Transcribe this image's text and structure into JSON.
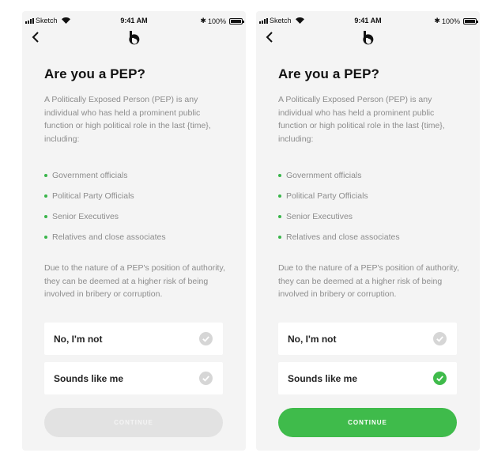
{
  "status_bar": {
    "carrier": "Sketch",
    "time": "9:41 AM",
    "battery": "100%"
  },
  "title": "Are you a PEP?",
  "intro": "A Politically Exposed Person (PEP) is any individual who has held a prominent public function or high political role in the last {time}, including:",
  "bullets": [
    "Government officials",
    "Political Party Officials",
    "Senior Executives",
    "Relatives and close associates"
  ],
  "explanation": "Due to the nature of a PEP's position of authority, they can be deemed at a higher risk of being involved in bribery or corruption.",
  "options": {
    "no": "No, I'm not",
    "yes": "Sounds like me"
  },
  "continue_label": "CONTINUE",
  "screens": [
    {
      "state": "unselected",
      "selected_option": null,
      "continue_enabled": false
    },
    {
      "state": "selected",
      "selected_option": "yes",
      "continue_enabled": true
    }
  ],
  "colors": {
    "accent": "#3fbb4b",
    "check_inactive": "#d6d6d6",
    "button_disabled": "#e2e2e2"
  },
  "icons": {
    "back": "chevron-left-icon",
    "logo": "brand-logo-icon",
    "check": "checkmark-circle-icon"
  }
}
